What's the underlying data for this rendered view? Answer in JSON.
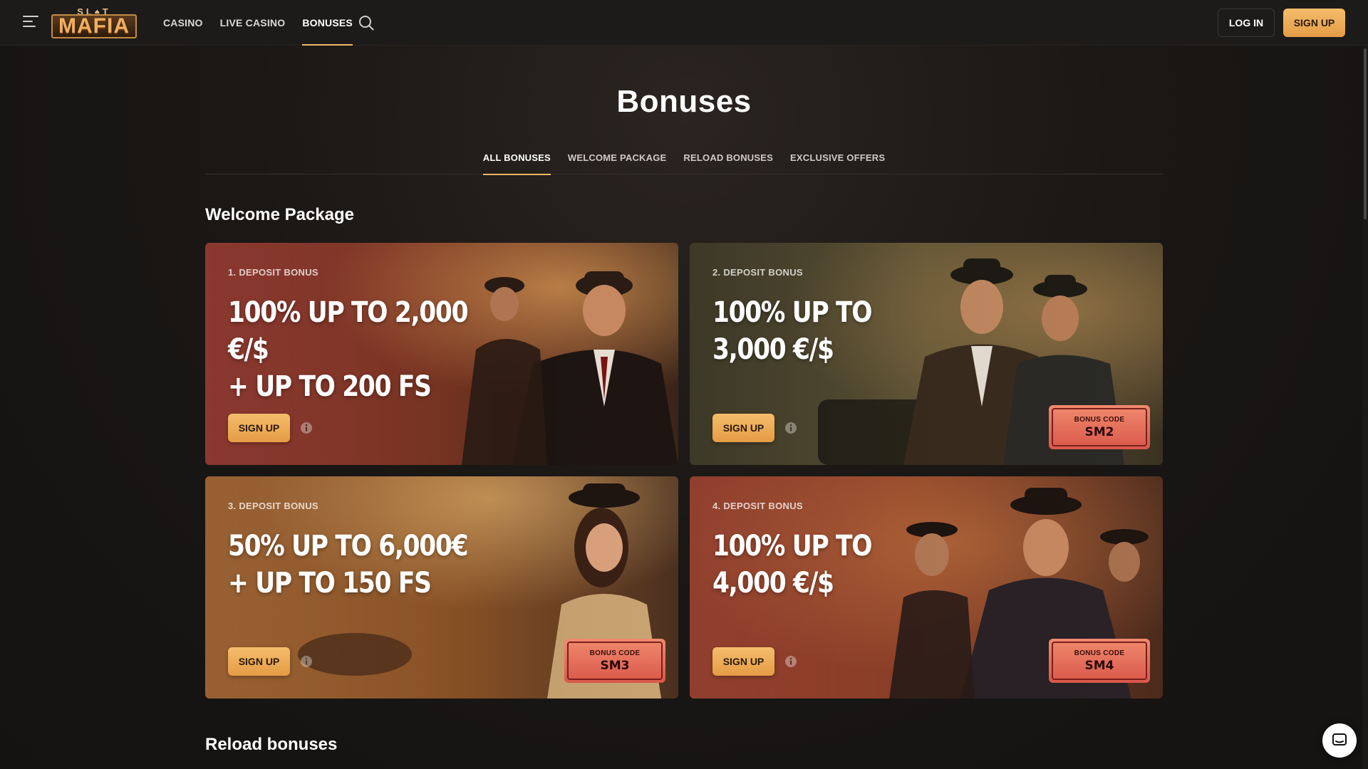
{
  "header": {
    "logo_top": "SL♠T",
    "logo_main": "MAFIA",
    "nav": [
      {
        "label": "CASINO"
      },
      {
        "label": "LIVE CASINO"
      },
      {
        "label": "BONUSES"
      }
    ],
    "login_label": "LOG IN",
    "signup_label": "SIGN UP",
    "search_icon": "search-icon",
    "menu_icon": "hamburger-menu-icon"
  },
  "page": {
    "title": "Bonuses",
    "tabs": [
      {
        "label": "ALL BONUSES"
      },
      {
        "label": "WELCOME PACKAGE"
      },
      {
        "label": "RELOAD BONUSES"
      },
      {
        "label": "EXCLUSIVE OFFERS"
      }
    ]
  },
  "welcome": {
    "title": "Welcome Package",
    "cards": [
      {
        "label": "1. DEPOSIT BONUS",
        "line1": "100% UP TO 2,000 €/$",
        "line2": "+ UP TO 200 FS",
        "button": "SIGN UP"
      },
      {
        "label": "2. DEPOSIT BONUS",
        "line1": "100% UP TO",
        "line2": "3,000 €/$",
        "button": "SIGN UP",
        "code_label": "BONUS CODE",
        "code": "SM2"
      },
      {
        "label": "3. DEPOSIT BONUS",
        "line1": "50% UP TO 6,000€",
        "line2": "+ UP TO 150 FS",
        "button": "SIGN UP",
        "code_label": "BONUS CODE",
        "code": "SM3"
      },
      {
        "label": "4. DEPOSIT BONUS",
        "line1": "100% UP TO",
        "line2": "4,000 €/$",
        "button": "SIGN UP",
        "code_label": "BONUS CODE",
        "code": "SM4"
      }
    ]
  },
  "reload": {
    "title": "Reload bonuses"
  },
  "colors": {
    "accent": "#f2b866",
    "button": "#e59c45",
    "background": "#161514"
  }
}
